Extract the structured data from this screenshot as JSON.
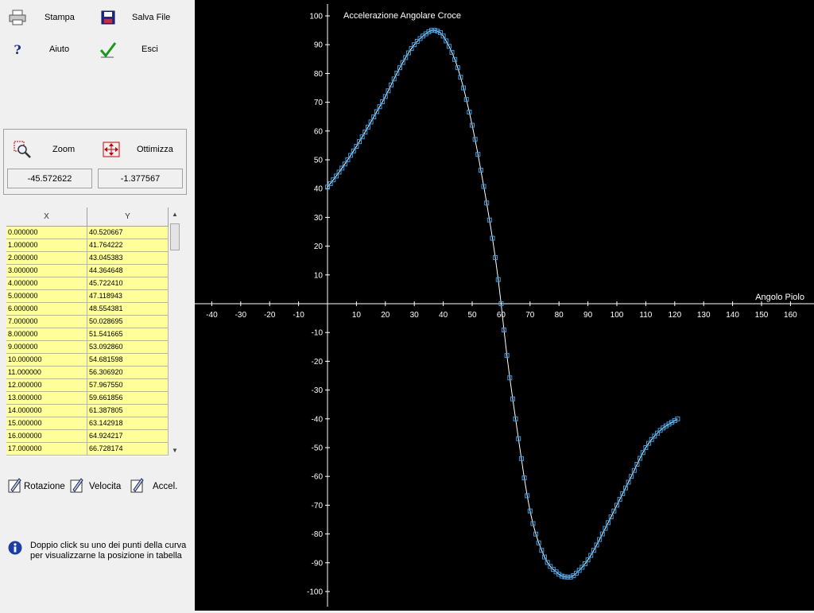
{
  "toolbar": {
    "print_label": "Stampa",
    "save_label": "Salva File",
    "help_label": "Aiuto",
    "exit_label": "Esci"
  },
  "view_group": {
    "zoom_label": "Zoom",
    "optimize_label": "Ottimizza",
    "cursor_x": "-45.572622",
    "cursor_y": "-1.377567"
  },
  "table": {
    "columns": [
      "X",
      "Y"
    ],
    "rows": [
      [
        "0.000000",
        "40.520667"
      ],
      [
        "1.000000",
        "41.764222"
      ],
      [
        "2.000000",
        "43.045383"
      ],
      [
        "3.000000",
        "44.364648"
      ],
      [
        "4.000000",
        "45.722410"
      ],
      [
        "5.000000",
        "47.118943"
      ],
      [
        "6.000000",
        "48.554381"
      ],
      [
        "7.000000",
        "50.028695"
      ],
      [
        "8.000000",
        "51.541665"
      ],
      [
        "9.000000",
        "53.092860"
      ],
      [
        "10.000000",
        "54.681598"
      ],
      [
        "11.000000",
        "56.306920"
      ],
      [
        "12.000000",
        "57.967550"
      ],
      [
        "13.000000",
        "59.661856"
      ],
      [
        "14.000000",
        "61.387805"
      ],
      [
        "15.000000",
        "63.142918"
      ],
      [
        "16.000000",
        "64.924217"
      ],
      [
        "17.000000",
        "66.728174"
      ]
    ]
  },
  "modes": {
    "rotation_label": "Rotazione",
    "velocity_label": "Velocita",
    "accel_label": "Accel."
  },
  "info": {
    "line1": "Doppio click su uno dei punti della curva",
    "line2": "per visualizzarne la posizione in tabella"
  },
  "colors": {
    "plot_bg": "#000000",
    "axis": "#ffffff",
    "curve": "#ffffff",
    "marker": "#3aa0e8",
    "grid_cell": "#ffff99"
  },
  "chart_data": {
    "type": "line",
    "title": "Accelerazione Angolare Croce",
    "xlabel": "Angolo Piolo",
    "ylabel": "",
    "xlim": [
      -45,
      165
    ],
    "ylim": [
      -105,
      105
    ],
    "x_ticks": [
      -40,
      -30,
      -20,
      -10,
      10,
      20,
      30,
      40,
      50,
      60,
      70,
      80,
      90,
      100,
      110,
      120,
      130,
      140,
      150,
      160
    ],
    "y_ticks": [
      100,
      90,
      80,
      70,
      60,
      50,
      40,
      30,
      20,
      10,
      -10,
      -20,
      -30,
      -40,
      -50,
      -60,
      -70,
      -80,
      -90,
      -100
    ],
    "grid": false,
    "series": [
      {
        "x": [
          0,
          1,
          2,
          3,
          4,
          5,
          6,
          7,
          8,
          9,
          10,
          11,
          12,
          13,
          14,
          15,
          16,
          17,
          20,
          25,
          30,
          35,
          37,
          40,
          45,
          50,
          55,
          58,
          60,
          62,
          65,
          70,
          75,
          80,
          83,
          85,
          90,
          95,
          100,
          105,
          110,
          115,
          121
        ],
        "y": [
          40.52,
          41.76,
          43.05,
          44.36,
          45.72,
          47.12,
          48.55,
          50.03,
          51.54,
          53.09,
          54.68,
          56.31,
          57.97,
          59.66,
          61.39,
          63.14,
          64.92,
          66.73,
          72,
          82,
          90,
          94.5,
          95,
          93,
          82,
          62,
          35,
          16,
          0,
          -18,
          -40,
          -72,
          -88,
          -94,
          -95,
          -94.5,
          -89,
          -80,
          -70,
          -60,
          -50,
          -44,
          -40
        ]
      }
    ]
  }
}
